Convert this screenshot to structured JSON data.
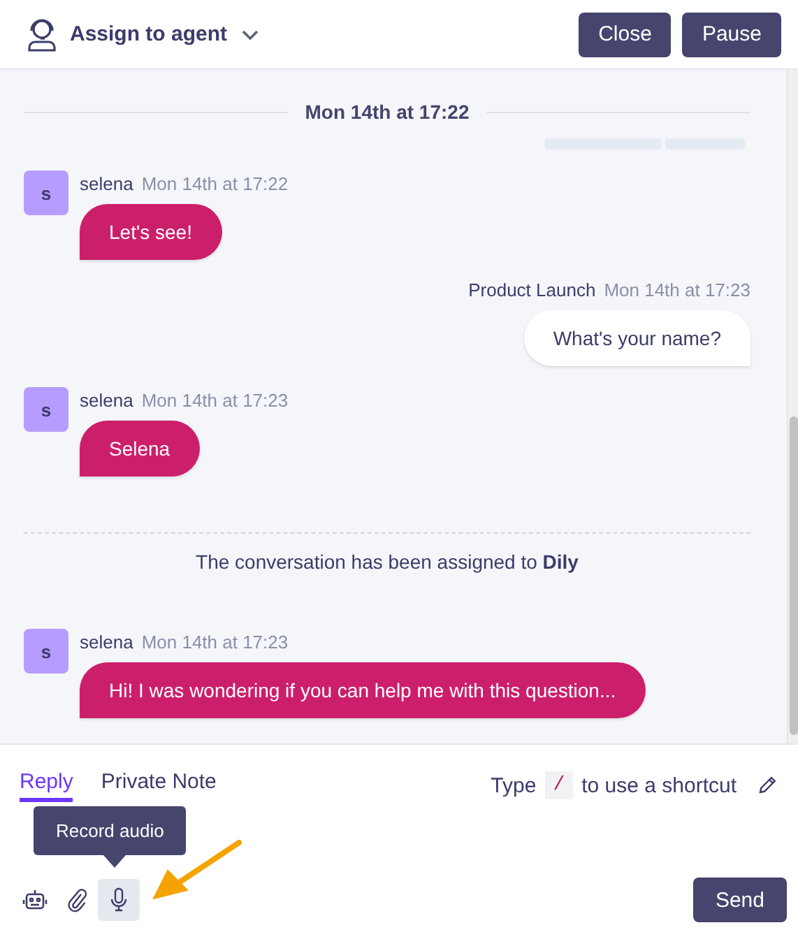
{
  "header": {
    "title": "Assign to agent",
    "buttons": [
      "Close",
      "Pause"
    ]
  },
  "messages": [
    {
      "kind": "divider",
      "text": "Mon 14th at 17:22"
    },
    {
      "kind": "loading"
    },
    {
      "kind": "incoming",
      "avatar": "s",
      "author": "selena",
      "time": "Mon 14th at 17:22",
      "text": "Let's see!"
    },
    {
      "kind": "outgoing",
      "author": "Product Launch",
      "time": "Mon 14th at 17:23",
      "text": "What's your name?"
    },
    {
      "kind": "incoming",
      "avatar": "s",
      "author": "selena",
      "time": "Mon 14th at 17:23",
      "text": "Selena"
    },
    {
      "kind": "activity",
      "text": "The conversation has been assigned to **Dily**"
    },
    {
      "kind": "incoming",
      "avatar": "s",
      "author": "selena",
      "time": "Mon 14th at 17:23",
      "text": "Hi! I was wondering if you can help me with this question..."
    }
  ],
  "composer": {
    "tabs": [
      {
        "label": "Reply",
        "selected": true
      },
      {
        "label": "Private Note",
        "selected": false
      }
    ],
    "hint": {
      "before": "Type",
      "key": "/",
      "after": "to use a shortcut"
    },
    "tooltip": "Record audio",
    "send": "Send"
  }
}
